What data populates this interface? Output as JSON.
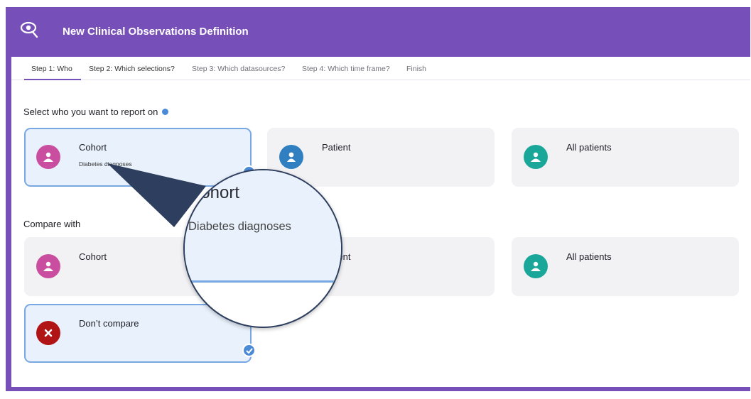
{
  "app": {
    "title": "New Clinical Observations Definition",
    "logo_icon": "magnifier-eye-logo"
  },
  "tabs": [
    {
      "label": "Step 1: Who",
      "active": true
    },
    {
      "label": "Step 2: Which selections?",
      "active": false
    },
    {
      "label": "Step 3: Which datasources?",
      "active": false
    },
    {
      "label": "Step 4: Which time frame?",
      "active": false
    },
    {
      "label": "Finish",
      "active": false
    }
  ],
  "report_on": {
    "title": "Select who you want to report on",
    "cards": [
      {
        "label": "Cohort",
        "sublabel": "Diabetes diagnoses",
        "icon": "group-icon",
        "color": "#c94e9f",
        "selected": true
      },
      {
        "label": "Patient",
        "icon": "person-icon",
        "color": "#2f7fc1",
        "selected": false
      },
      {
        "label": "All patients",
        "icon": "group-icon",
        "color": "#1aa79a",
        "selected": false
      }
    ]
  },
  "compare_with": {
    "title": "Compare with",
    "cards": [
      {
        "label": "Cohort",
        "icon": "group-icon",
        "color": "#c94e9f",
        "selected": false
      },
      {
        "label": "Patient",
        "icon": "person-icon",
        "color": "#2f7fc1",
        "selected": false
      },
      {
        "label": "All patients",
        "icon": "group-icon",
        "color": "#1aa79a",
        "selected": false
      },
      {
        "label": "Don’t compare",
        "icon": "close-icon",
        "color": "#b01414",
        "selected": true
      }
    ]
  },
  "magnifier": {
    "label": "Cohort",
    "sublabel": "Diabetes diagnoses"
  },
  "colors": {
    "brand": "#7650b8",
    "selected_border": "#78a8e4",
    "check": "#4a8ad6"
  }
}
